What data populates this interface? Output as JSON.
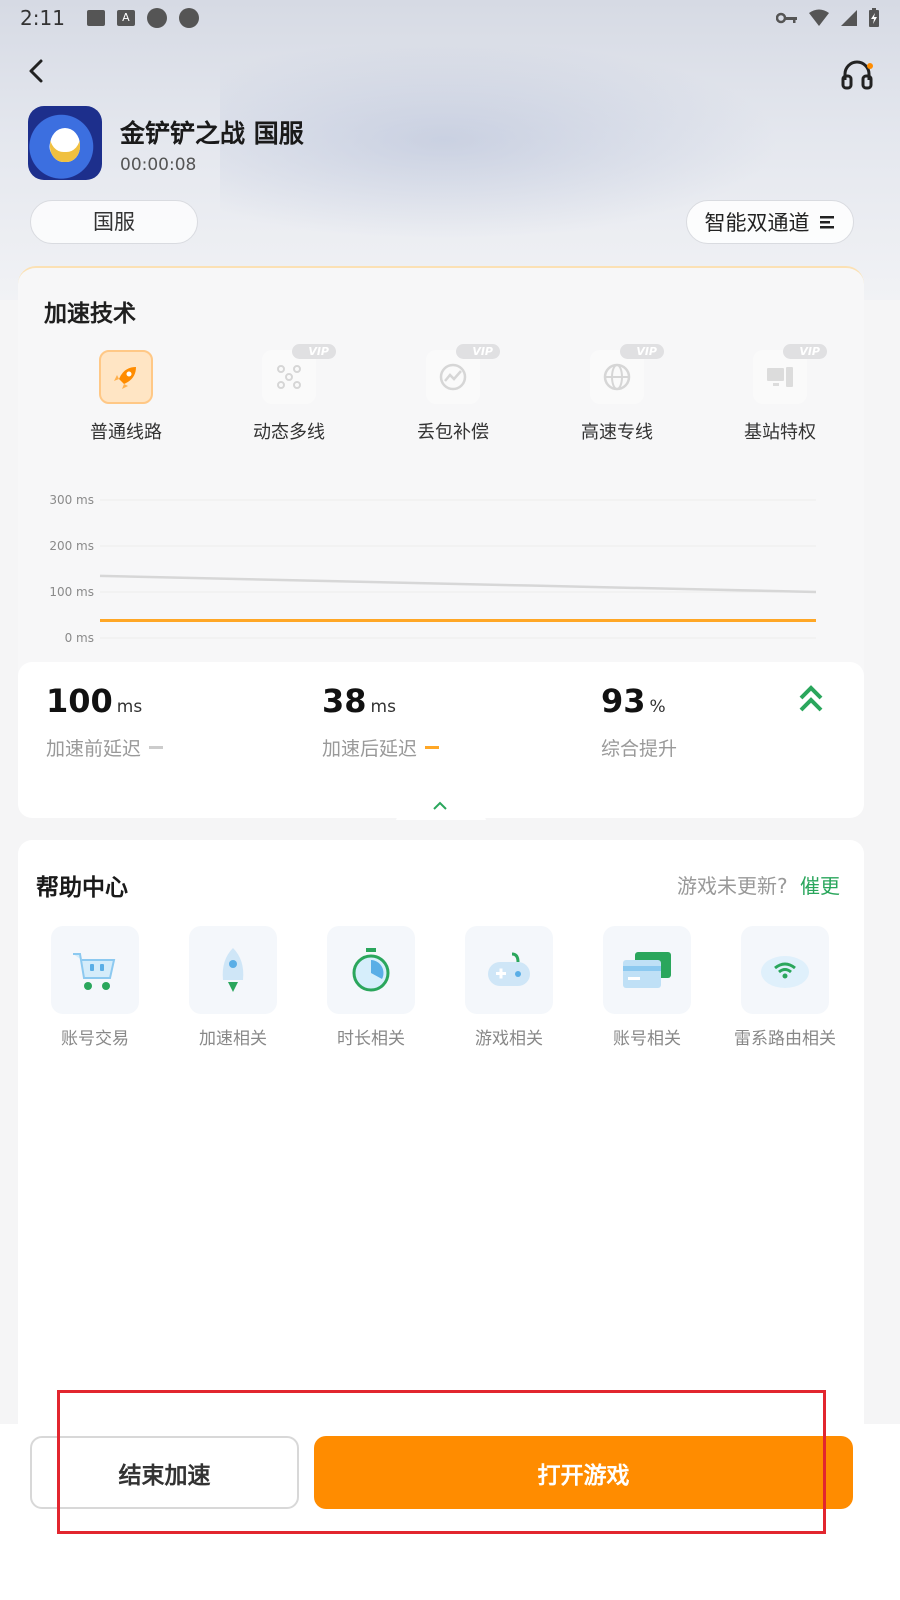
{
  "status_bar": {
    "time": "2:11",
    "note_icon": "A"
  },
  "game": {
    "name": "金铲铲之战 国服",
    "elapsed": "00:00:08"
  },
  "region_chip": "国服",
  "mode_chip": "智能双通道",
  "accel_tech": {
    "title": "加速技术",
    "items": [
      {
        "label": "普通线路",
        "icon": "rocket-icon",
        "vip": false,
        "active": true
      },
      {
        "label": "动态多线",
        "icon": "multiline-icon",
        "vip": true,
        "vip_text": "VIP"
      },
      {
        "label": "丢包补偿",
        "icon": "compensation-icon",
        "vip": true,
        "vip_text": "VIP"
      },
      {
        "label": "高速专线",
        "icon": "globe-icon",
        "vip": true,
        "vip_text": "VIP"
      },
      {
        "label": "基站特权",
        "icon": "base-station-icon",
        "vip": true,
        "vip_text": "VIP"
      }
    ]
  },
  "chart_data": {
    "type": "line",
    "title": "",
    "xlabel": "",
    "ylabel": "",
    "yticks": [
      "300 ms",
      "200 ms",
      "100 ms",
      "0 ms"
    ],
    "ylim": [
      0,
      300
    ],
    "x": [
      0,
      1,
      2,
      3,
      4,
      5
    ],
    "series": [
      {
        "color": "#d7d7d7",
        "values": [
          135,
          128,
          121,
          114,
          107,
          100
        ]
      },
      {
        "color": "#ffa726",
        "values": [
          38,
          38,
          38,
          38,
          38,
          38
        ]
      }
    ],
    "grid": true
  },
  "stats": {
    "before": {
      "value": "100",
      "unit": "ms",
      "caption": "加速前延迟",
      "color": "#cccccc"
    },
    "after": {
      "value": "38",
      "unit": "ms",
      "caption": "加速后延迟",
      "color": "#ffa726"
    },
    "improve": {
      "value": "93",
      "unit": "%",
      "caption": "综合提升"
    }
  },
  "help": {
    "title": "帮助中心",
    "question": "游戏未更新?",
    "link": "催更",
    "items": [
      {
        "label": "账号交易",
        "icon": "cart-icon"
      },
      {
        "label": "加速相关",
        "icon": "rocket-icon"
      },
      {
        "label": "时长相关",
        "icon": "stopwatch-icon"
      },
      {
        "label": "游戏相关",
        "icon": "gamepad-icon"
      },
      {
        "label": "账号相关",
        "icon": "card-icon"
      },
      {
        "label": "雷系路由相关",
        "icon": "router-icon"
      }
    ]
  },
  "actions": {
    "end": "结束加速",
    "open": "打开游戏"
  },
  "colors": {
    "accent": "#ff8c00",
    "green": "#2aa65c",
    "highlight": "#e2262f"
  }
}
